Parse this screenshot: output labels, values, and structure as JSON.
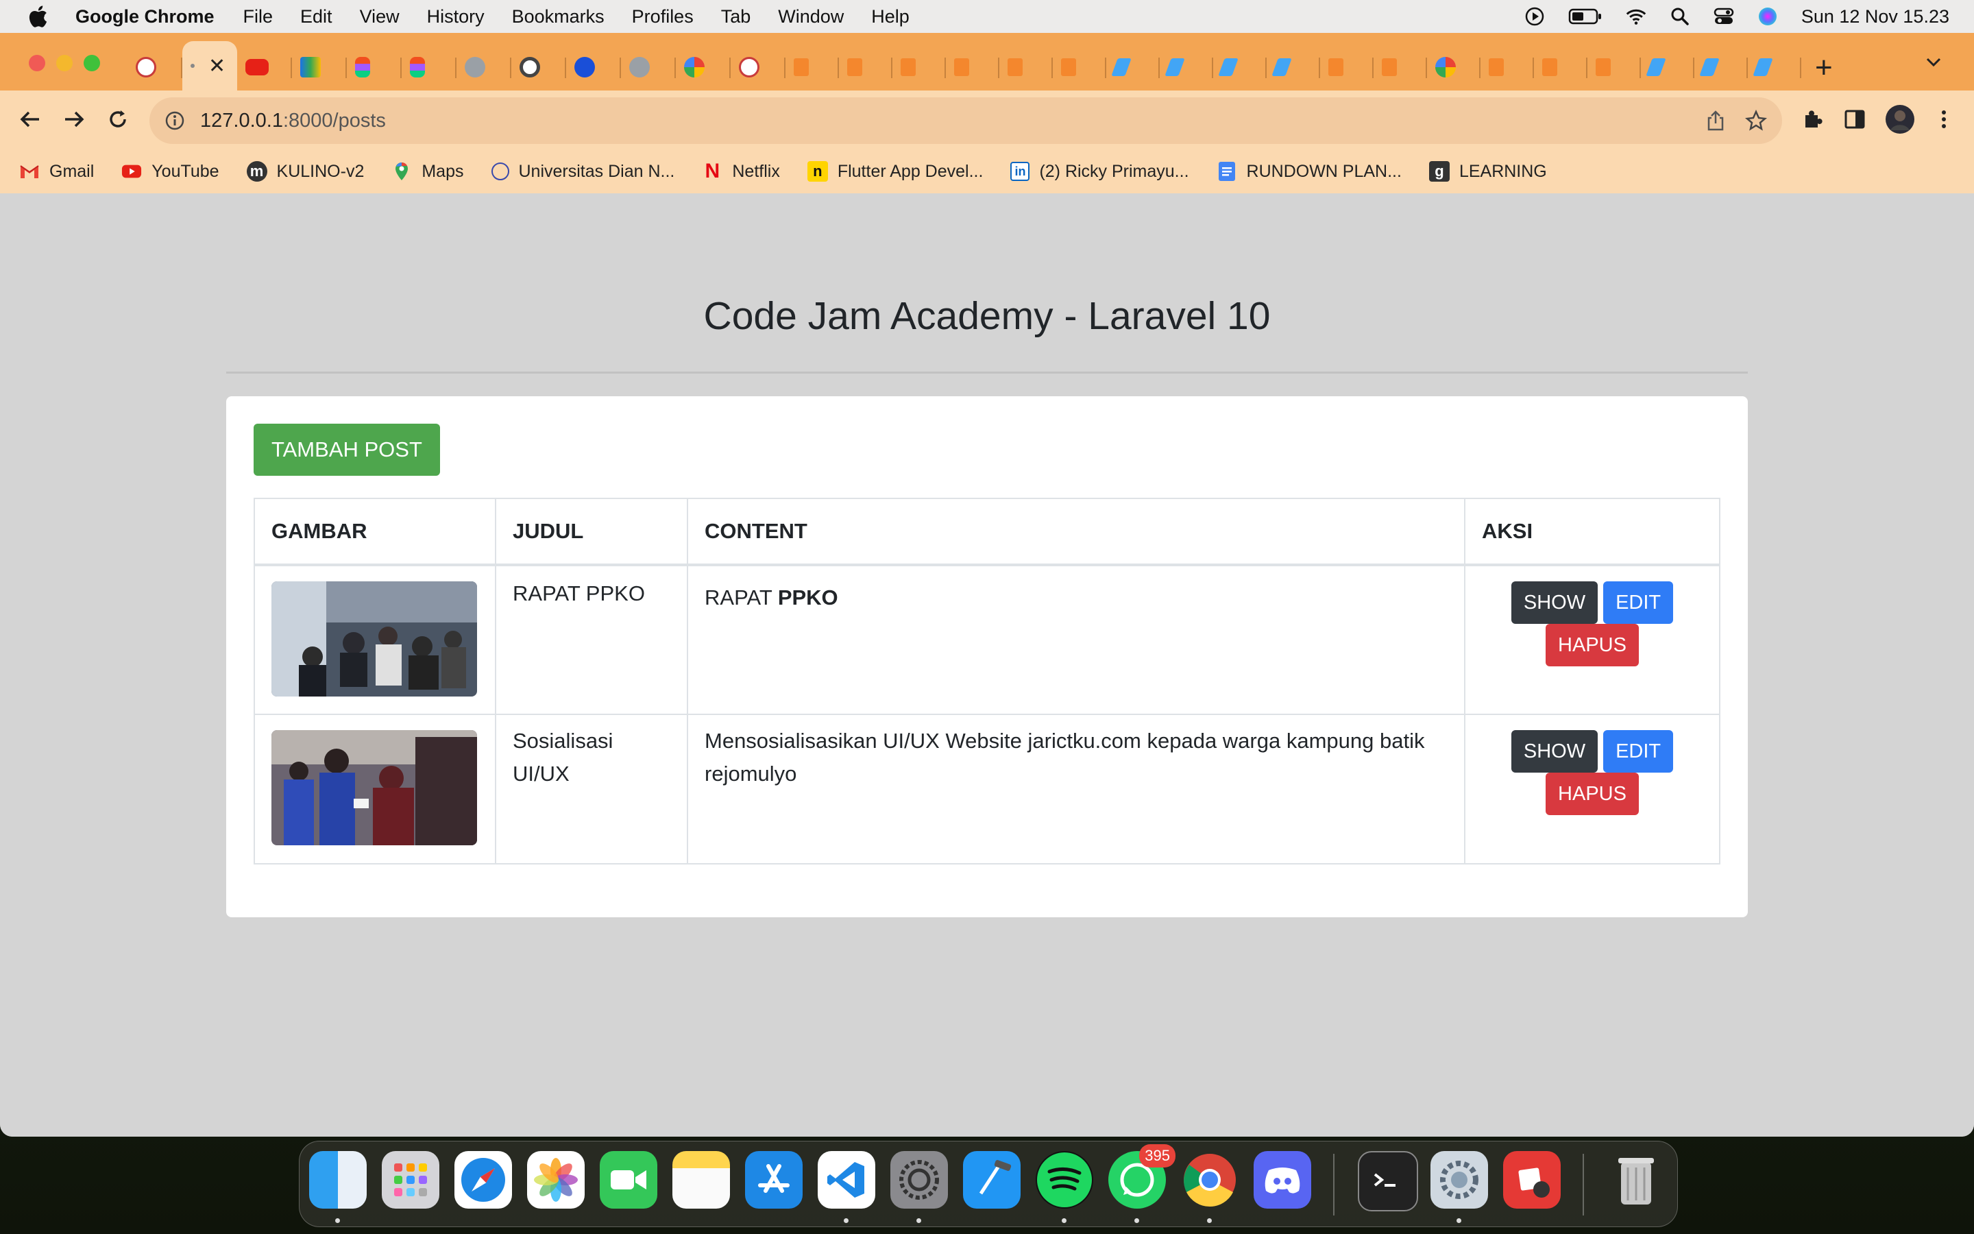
{
  "menubar": {
    "app_name": "Google Chrome",
    "items": [
      "File",
      "Edit",
      "View",
      "History",
      "Bookmarks",
      "Profiles",
      "Tab",
      "Window",
      "Help"
    ],
    "clock": "Sun 12 Nov  15.23"
  },
  "browser": {
    "active_tab_close": "✕",
    "address": {
      "host": "127.0.0.1",
      "path": ":8000/posts"
    },
    "bookmarks": [
      {
        "label": "Gmail",
        "icon": "gmail-icon"
      },
      {
        "label": "YouTube",
        "icon": "youtube-icon"
      },
      {
        "label": "KULINO-v2",
        "icon": "kulino-icon"
      },
      {
        "label": "Maps",
        "icon": "maps-icon"
      },
      {
        "label": "Universitas Dian N...",
        "icon": "udinus-icon"
      },
      {
        "label": "Netflix",
        "icon": "netflix-icon"
      },
      {
        "label": "Flutter App Devel...",
        "icon": "notion-icon"
      },
      {
        "label": "(2) Ricky Primayu...",
        "icon": "linkedin-icon"
      },
      {
        "label": "RUNDOWN PLAN...",
        "icon": "docs-icon"
      },
      {
        "label": "LEARNING",
        "icon": "learning-icon"
      }
    ]
  },
  "page": {
    "title": "Code Jam Academy - Laravel 10",
    "add_button": "TAMBAH POST",
    "table": {
      "headers": [
        "GAMBAR",
        "JUDUL",
        "CONTENT",
        "AKSI"
      ],
      "rows": [
        {
          "judul": "RAPAT PPKO",
          "content_plain": "RAPAT ",
          "content_bold": "PPKO"
        },
        {
          "judul": "Sosialisasi UI/UX",
          "content_plain": "Mensosialisasikan UI/UX Website jarictku.com kepada warga kampung batik rejomulyo",
          "content_bold": ""
        }
      ],
      "actions": {
        "show": "SHOW",
        "edit": "EDIT",
        "delete": "HAPUS"
      }
    }
  },
  "dock": {
    "whatsapp_badge": "395"
  },
  "colors": {
    "tabstrip": "#f3a553",
    "toolbar": "#fbd9b0",
    "add_button": "#4ea64d",
    "show_button": "#343a40",
    "edit_button": "#2f7cf6",
    "delete_button": "#d8393f"
  }
}
